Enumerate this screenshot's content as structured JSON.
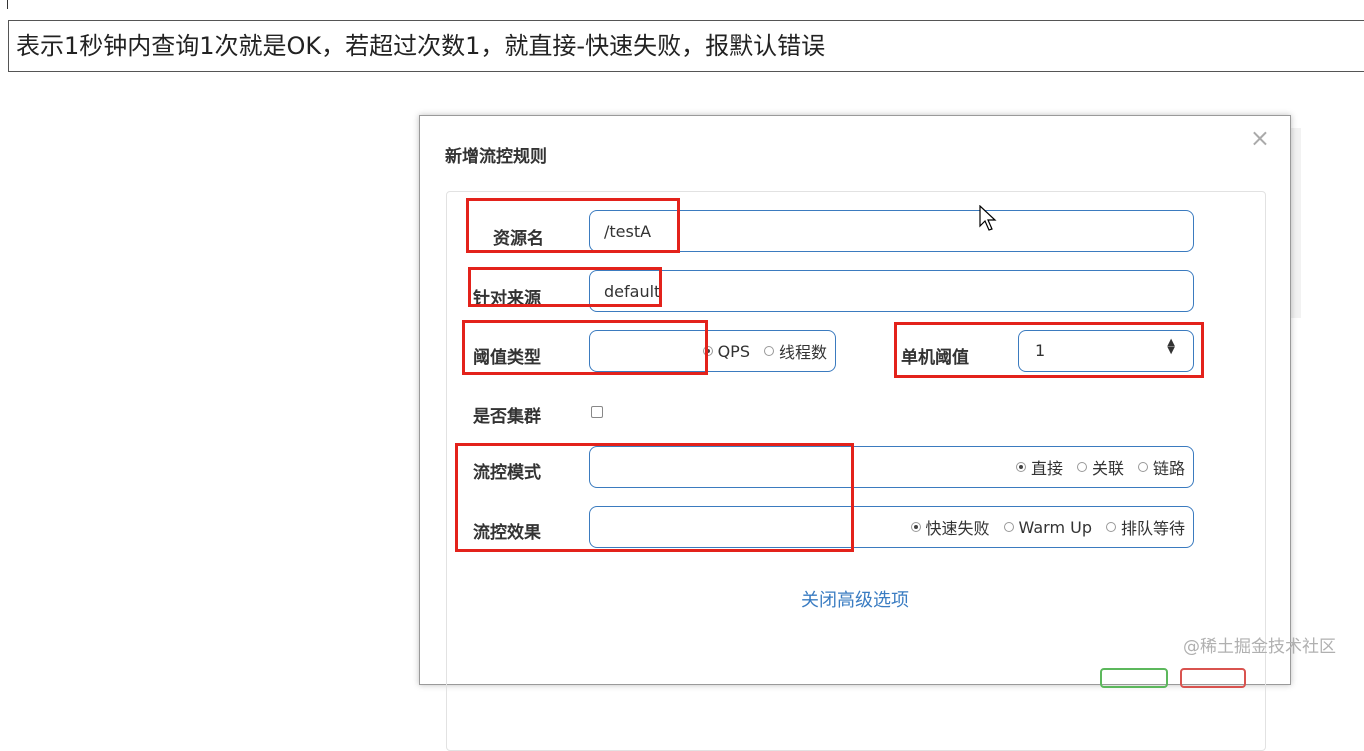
{
  "note": {
    "text": "表示1秒钟内查询1次就是OK，若超过次数1，就直接-快速失败，报默认错误"
  },
  "modal": {
    "title": "新增流控规则",
    "close": "×",
    "fields": {
      "resource": {
        "label": "资源名",
        "value": "/testA"
      },
      "origin": {
        "label": "针对来源",
        "value": "default"
      },
      "threshold_type": {
        "label": "阈值类型",
        "options": [
          "QPS",
          "线程数"
        ],
        "selected": "QPS"
      },
      "single_threshold": {
        "label": "单机阈值",
        "value": "1"
      },
      "cluster": {
        "label": "是否集群",
        "checked": false
      },
      "control_mode": {
        "label": "流控模式",
        "options": [
          "直接",
          "关联",
          "链路"
        ],
        "selected": "直接"
      },
      "control_effect": {
        "label": "流控效果",
        "options": [
          "快速失败",
          "Warm Up",
          "排队等待"
        ],
        "selected": "快速失败"
      }
    },
    "advanced_link": "关闭高级选项"
  },
  "colors": {
    "highlight": "#e3221b",
    "link": "#3a7cc2",
    "input_border": "#3b7bbf"
  },
  "watermark": "@稀土掘金技术社区"
}
